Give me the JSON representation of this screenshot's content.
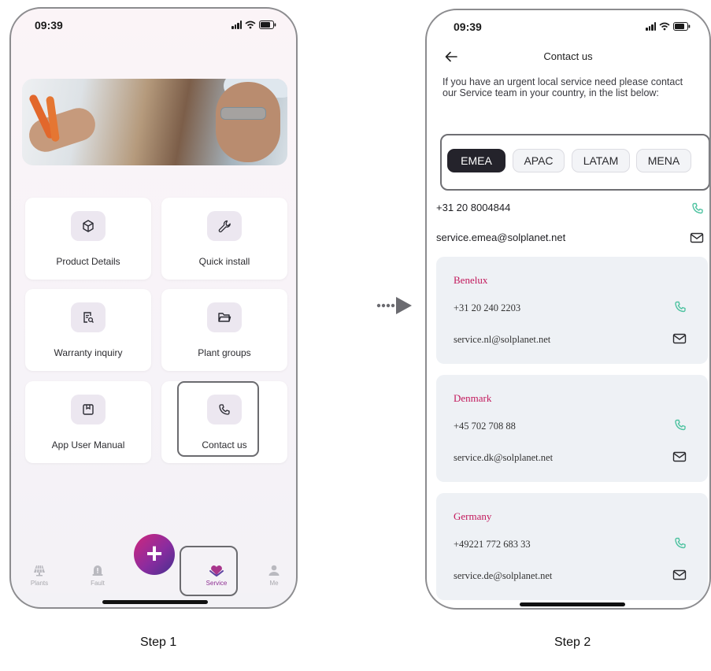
{
  "colors": {
    "accent": "#c2185b",
    "dark_chip": "#24232b",
    "phone_icon": "#4fc3a1",
    "fab_gradient_start": "#d0277c",
    "fab_gradient_end": "#46308f"
  },
  "step1": {
    "status_time": "09:39",
    "hero_image": "technician-with-pliers-photo",
    "cards": [
      {
        "label": "Product Details",
        "icon": "cube-icon"
      },
      {
        "label": "Quick install",
        "icon": "wrench-icon"
      },
      {
        "label": "Warranty inquiry",
        "icon": "document-search-icon"
      },
      {
        "label": "Plant groups",
        "icon": "folder-icon"
      },
      {
        "label": "App User Manual",
        "icon": "manual-icon"
      },
      {
        "label": "Contact us",
        "icon": "phone-icon"
      }
    ],
    "fab_label": "+",
    "tabs": [
      {
        "label": "Plants",
        "icon": "solar-panel-icon"
      },
      {
        "label": "Fault",
        "icon": "alert-icon"
      },
      {
        "label": "Service",
        "icon": "heart-hands-icon",
        "active": true
      },
      {
        "label": "Me",
        "icon": "user-icon"
      }
    ]
  },
  "step2": {
    "status_time": "09:39",
    "title": "Contact us",
    "intro": "If you have an urgent local service need please contact our Service team in your country, in the list below:",
    "regions": [
      "EMEA",
      "APAC",
      "LATAM",
      "MENA"
    ],
    "selected_region": "EMEA",
    "main_phone": "+31 20 8004844",
    "main_email": "service.emea@solplanet.net",
    "countries": [
      {
        "name": "Benelux",
        "phone": "+31 20 240 2203",
        "email": "service.nl@solplanet.net"
      },
      {
        "name": "Denmark",
        "phone": "+45 702 708 88",
        "email": "service.dk@solplanet.net"
      },
      {
        "name": "Germany",
        "phone": "+49221 772 683 33",
        "email": "service.de@solplanet.net"
      }
    ]
  },
  "captions": {
    "step1": "Step 1",
    "step2": "Step 2"
  }
}
